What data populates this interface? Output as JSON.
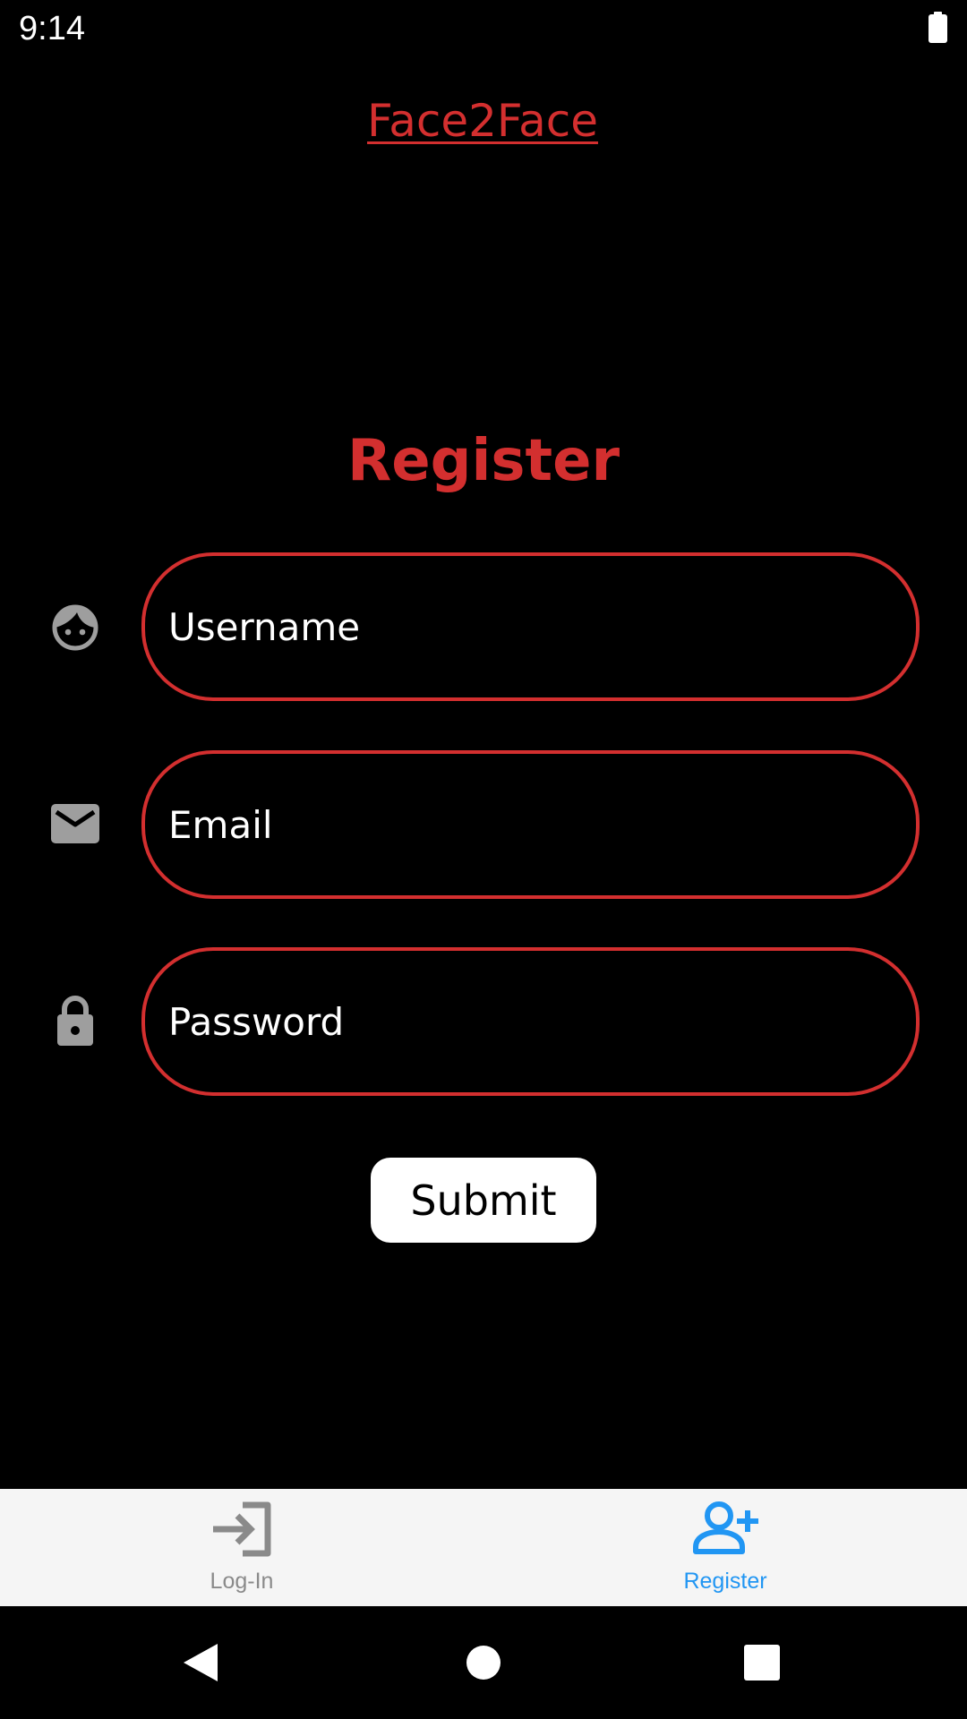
{
  "status_bar": {
    "time": "9:14",
    "battery_icon": "battery-full-icon"
  },
  "app": {
    "title": "Face2Face",
    "accent_color": "#d32f2f"
  },
  "form": {
    "heading": "Register",
    "username": {
      "placeholder": "Username",
      "value": "",
      "icon": "face-icon"
    },
    "email": {
      "placeholder": "Email",
      "value": "",
      "icon": "email-icon"
    },
    "password": {
      "placeholder": "Password",
      "value": "",
      "icon": "lock-icon"
    },
    "submit_label": "Submit"
  },
  "bottom_nav": {
    "items": [
      {
        "label": "Log-In",
        "icon": "login-icon",
        "active": false,
        "color": "#8a8a8a"
      },
      {
        "label": "Register",
        "icon": "person-add-icon",
        "active": true,
        "color": "#2196f3"
      }
    ]
  },
  "system_nav": {
    "back": "back-icon",
    "home": "home-icon",
    "recents": "recents-icon"
  }
}
